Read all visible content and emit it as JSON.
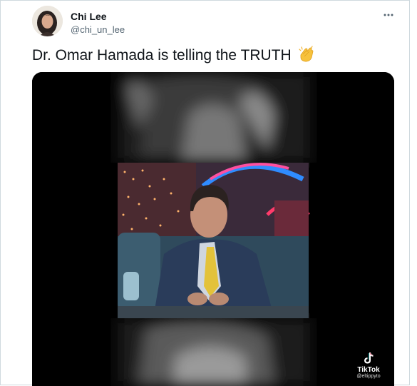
{
  "author": {
    "name": "Chi Lee",
    "handle": "@chi_un_lee"
  },
  "tweet": {
    "text": "Dr. Omar Hamada is telling the TRUTH",
    "emoji": "clapping-hands-emoji"
  },
  "media": {
    "type": "video",
    "watermark": {
      "brand": "TikTok",
      "user": "@eltippyto"
    }
  },
  "icons": {
    "more": "more-options-icon",
    "tiktok": "tiktok-logo-icon"
  },
  "colors": {
    "text": "#0f1419",
    "secondary": "#536471",
    "border": "#cfd9de",
    "media_bg": "#000000"
  }
}
